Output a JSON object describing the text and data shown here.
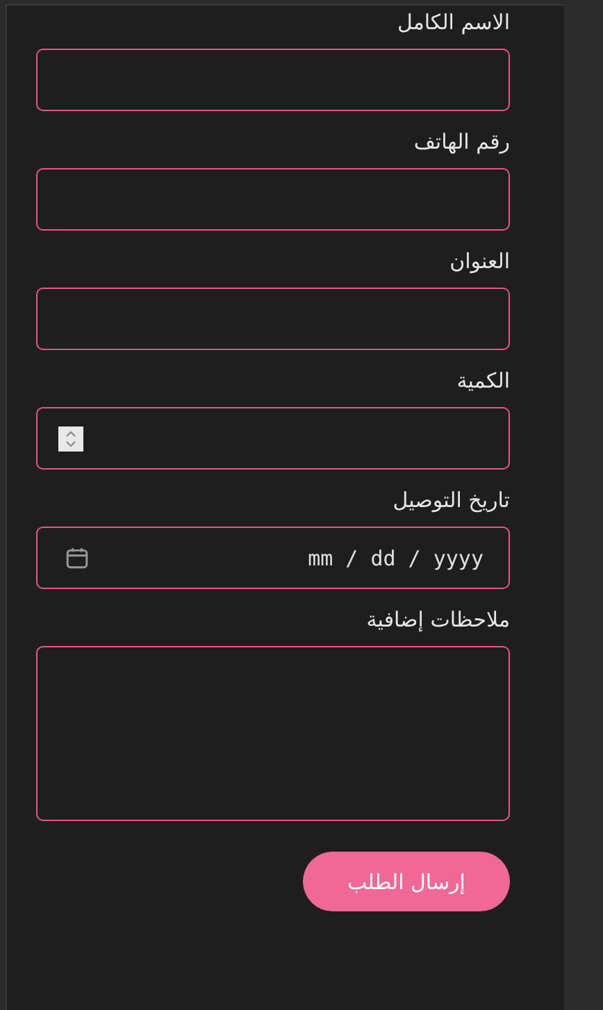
{
  "form": {
    "fields": [
      {
        "label": "الاسم الكامل",
        "kind": "text"
      },
      {
        "label": "رقم الهاتف",
        "kind": "text"
      },
      {
        "label": "العنوان",
        "kind": "text"
      },
      {
        "label": "الكمية",
        "kind": "number"
      },
      {
        "label": "تاريخ التوصيل",
        "kind": "date",
        "placeholder": "mm / dd / yyyy"
      },
      {
        "label": "ملاحظات إضافية",
        "kind": "textarea"
      }
    ],
    "submit": "إرسال الطلب"
  }
}
